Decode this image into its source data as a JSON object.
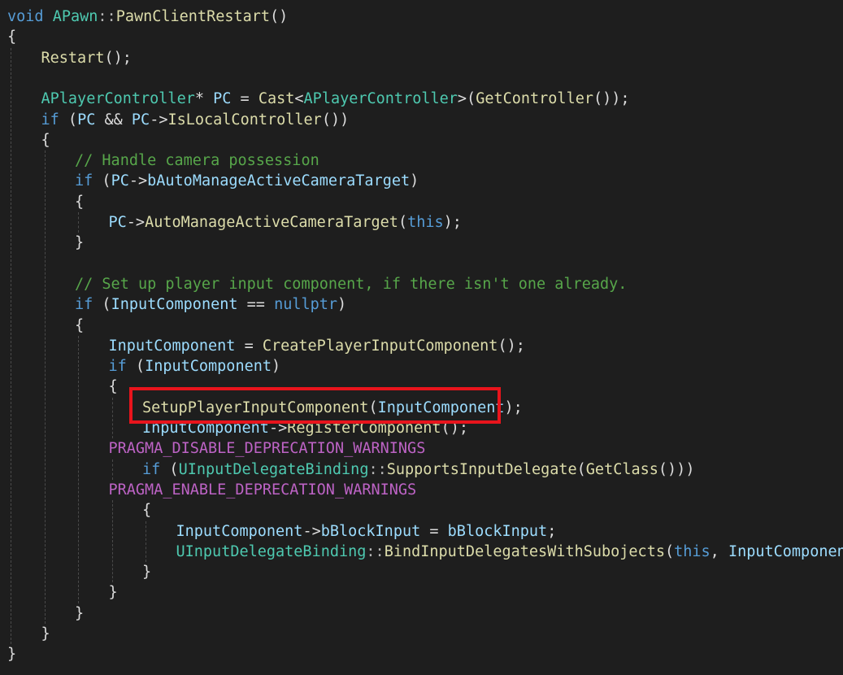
{
  "editor": {
    "theme": {
      "background": "#1e1e1e",
      "keyword": "#569cd6",
      "type": "#4ec9b0",
      "function": "#dcdcaa",
      "comment": "#57a64a",
      "macro": "#bd63c5",
      "identifier": "#9cdcfe",
      "plain": "#dcdcdc",
      "operator": "#b4b4b4",
      "highlight_border": "#e8141c"
    },
    "lines": [
      {
        "indent": 0,
        "tokens": [
          [
            "void",
            "keyword"
          ],
          [
            " ",
            "plain"
          ],
          [
            "APawn",
            "type"
          ],
          [
            "::",
            "operator"
          ],
          [
            "PawnClientRestart",
            "function"
          ],
          [
            "()",
            "plain"
          ]
        ]
      },
      {
        "indent": 0,
        "tokens": [
          [
            "{",
            "plain"
          ]
        ]
      },
      {
        "indent": 1,
        "tokens": [
          [
            "Restart",
            "function"
          ],
          [
            "();",
            "plain"
          ]
        ]
      },
      {
        "indent": 0,
        "tokens": []
      },
      {
        "indent": 1,
        "tokens": [
          [
            "APlayerController",
            "type"
          ],
          [
            "* ",
            "plain"
          ],
          [
            "PC",
            "identifier"
          ],
          [
            " = ",
            "plain"
          ],
          [
            "Cast",
            "function"
          ],
          [
            "<",
            "plain"
          ],
          [
            "APlayerController",
            "type"
          ],
          [
            ">(",
            "plain"
          ],
          [
            "GetController",
            "function"
          ],
          [
            "());",
            "plain"
          ]
        ]
      },
      {
        "indent": 1,
        "tokens": [
          [
            "if",
            "keyword"
          ],
          [
            " (",
            "plain"
          ],
          [
            "PC",
            "identifier"
          ],
          [
            " && ",
            "plain"
          ],
          [
            "PC",
            "identifier"
          ],
          [
            "->",
            "plain"
          ],
          [
            "IsLocalController",
            "function"
          ],
          [
            "())",
            "plain"
          ]
        ]
      },
      {
        "indent": 1,
        "tokens": [
          [
            "{",
            "plain"
          ]
        ]
      },
      {
        "indent": 2,
        "tokens": [
          [
            "// Handle camera possession",
            "comment"
          ]
        ]
      },
      {
        "indent": 2,
        "tokens": [
          [
            "if",
            "keyword"
          ],
          [
            " (",
            "plain"
          ],
          [
            "PC",
            "identifier"
          ],
          [
            "->",
            "plain"
          ],
          [
            "bAutoManageActiveCameraTarget",
            "identifier"
          ],
          [
            ")",
            "plain"
          ]
        ]
      },
      {
        "indent": 2,
        "tokens": [
          [
            "{",
            "plain"
          ]
        ]
      },
      {
        "indent": 3,
        "tokens": [
          [
            "PC",
            "identifier"
          ],
          [
            "->",
            "plain"
          ],
          [
            "AutoManageActiveCameraTarget",
            "function"
          ],
          [
            "(",
            "plain"
          ],
          [
            "this",
            "keyword"
          ],
          [
            ");",
            "plain"
          ]
        ]
      },
      {
        "indent": 2,
        "tokens": [
          [
            "}",
            "plain"
          ]
        ]
      },
      {
        "indent": 0,
        "tokens": []
      },
      {
        "indent": 2,
        "tokens": [
          [
            "// Set up player input component, if there isn't one already.",
            "comment"
          ]
        ]
      },
      {
        "indent": 2,
        "tokens": [
          [
            "if",
            "keyword"
          ],
          [
            " (",
            "plain"
          ],
          [
            "InputComponent",
            "identifier"
          ],
          [
            " == ",
            "plain"
          ],
          [
            "nullptr",
            "keyword"
          ],
          [
            ")",
            "plain"
          ]
        ]
      },
      {
        "indent": 2,
        "tokens": [
          [
            "{",
            "plain"
          ]
        ]
      },
      {
        "indent": 3,
        "tokens": [
          [
            "InputComponent",
            "identifier"
          ],
          [
            " = ",
            "plain"
          ],
          [
            "CreatePlayerInputComponent",
            "function"
          ],
          [
            "();",
            "plain"
          ]
        ]
      },
      {
        "indent": 3,
        "tokens": [
          [
            "if",
            "keyword"
          ],
          [
            " (",
            "plain"
          ],
          [
            "InputComponent",
            "identifier"
          ],
          [
            ")",
            "plain"
          ]
        ]
      },
      {
        "indent": 3,
        "tokens": [
          [
            "{",
            "plain"
          ]
        ]
      },
      {
        "indent": 4,
        "tokens": [
          [
            "SetupPlayerInputComponent",
            "function"
          ],
          [
            "(",
            "plain"
          ],
          [
            "InputComponent",
            "identifier"
          ],
          [
            ");",
            "plain"
          ]
        ]
      },
      {
        "indent": 4,
        "tokens": [
          [
            "InputComponent",
            "identifier"
          ],
          [
            "->",
            "plain"
          ],
          [
            "RegisterComponent",
            "function"
          ],
          [
            "();",
            "plain"
          ]
        ]
      },
      {
        "indent": 3,
        "tokens": [
          [
            "PRAGMA_DISABLE_DEPRECATION_WARNINGS",
            "macro"
          ]
        ]
      },
      {
        "indent": 4,
        "tokens": [
          [
            "if",
            "keyword"
          ],
          [
            " (",
            "plain"
          ],
          [
            "UInputDelegateBinding",
            "type"
          ],
          [
            "::",
            "operator"
          ],
          [
            "SupportsInputDelegate",
            "function"
          ],
          [
            "(",
            "plain"
          ],
          [
            "GetClass",
            "function"
          ],
          [
            "()))",
            "plain"
          ]
        ]
      },
      {
        "indent": 3,
        "tokens": [
          [
            "PRAGMA_ENABLE_DEPRECATION_WARNINGS",
            "macro"
          ]
        ]
      },
      {
        "indent": 4,
        "tokens": [
          [
            "{",
            "plain"
          ]
        ]
      },
      {
        "indent": 5,
        "tokens": [
          [
            "InputComponent",
            "identifier"
          ],
          [
            "->",
            "plain"
          ],
          [
            "bBlockInput",
            "identifier"
          ],
          [
            " = ",
            "plain"
          ],
          [
            "bBlockInput",
            "identifier"
          ],
          [
            ";",
            "plain"
          ]
        ]
      },
      {
        "indent": 5,
        "tokens": [
          [
            "UInputDelegateBinding",
            "type"
          ],
          [
            "::",
            "operator"
          ],
          [
            "BindInputDelegatesWithSubojects",
            "function"
          ],
          [
            "(",
            "plain"
          ],
          [
            "this",
            "keyword"
          ],
          [
            ", ",
            "plain"
          ],
          [
            "InputComponent",
            "identifier"
          ],
          [
            ");",
            "plain"
          ]
        ]
      },
      {
        "indent": 4,
        "tokens": [
          [
            "}",
            "plain"
          ]
        ]
      },
      {
        "indent": 3,
        "tokens": [
          [
            "}",
            "plain"
          ]
        ]
      },
      {
        "indent": 2,
        "tokens": [
          [
            "}",
            "plain"
          ]
        ]
      },
      {
        "indent": 1,
        "tokens": [
          [
            "}",
            "plain"
          ]
        ]
      },
      {
        "indent": 0,
        "tokens": [
          [
            "}",
            "plain"
          ]
        ]
      }
    ],
    "highlighted_line_index": 19
  }
}
